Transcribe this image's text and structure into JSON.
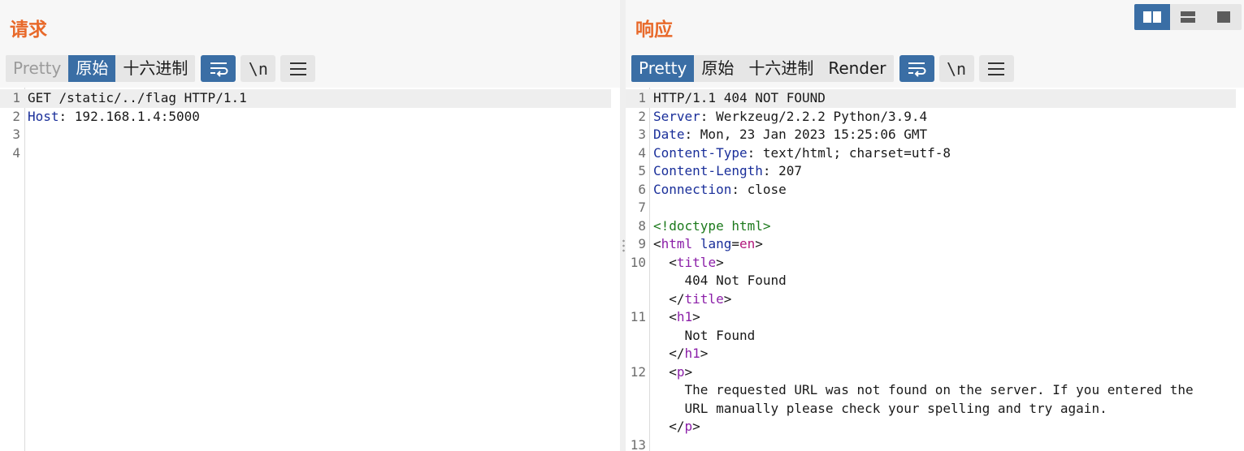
{
  "request": {
    "title": "请求",
    "view_tabs": [
      {
        "label": "Pretty",
        "state": "disabled"
      },
      {
        "label": "原始",
        "state": "active"
      },
      {
        "label": "十六进制",
        "state": "normal"
      }
    ],
    "newline_label": "\\n",
    "lines": [
      {
        "num": "1",
        "parts": [
          {
            "t": "GET /static/../flag HTTP/1.1",
            "c": ""
          }
        ]
      },
      {
        "num": "2",
        "parts": [
          {
            "t": "Host",
            "c": "hk"
          },
          {
            "t": ": 192.168.1.4:5000",
            "c": ""
          }
        ]
      },
      {
        "num": "3",
        "parts": []
      },
      {
        "num": "4",
        "parts": []
      }
    ]
  },
  "response": {
    "title": "响应",
    "view_tabs": [
      {
        "label": "Pretty",
        "state": "active"
      },
      {
        "label": "原始",
        "state": "normal"
      },
      {
        "label": "十六进制",
        "state": "normal"
      },
      {
        "label": "Render",
        "state": "normal"
      }
    ],
    "newline_label": "\\n",
    "lines": [
      {
        "num": "1",
        "parts": [
          {
            "t": "HTTP/1.1 404 NOT FOUND",
            "c": ""
          }
        ]
      },
      {
        "num": "2",
        "parts": [
          {
            "t": "Server",
            "c": "hk"
          },
          {
            "t": ": Werkzeug/2.2.2 Python/3.9.4",
            "c": ""
          }
        ]
      },
      {
        "num": "3",
        "parts": [
          {
            "t": "Date",
            "c": "hk"
          },
          {
            "t": ": Mon, 23 Jan 2023 15:25:06 GMT",
            "c": ""
          }
        ]
      },
      {
        "num": "4",
        "parts": [
          {
            "t": "Content-Type",
            "c": "hk"
          },
          {
            "t": ": text/html; charset=utf-8",
            "c": ""
          }
        ]
      },
      {
        "num": "5",
        "parts": [
          {
            "t": "Content-Length",
            "c": "hk"
          },
          {
            "t": ": 207",
            "c": ""
          }
        ]
      },
      {
        "num": "6",
        "parts": [
          {
            "t": "Connection",
            "c": "hk"
          },
          {
            "t": ": close",
            "c": ""
          }
        ]
      },
      {
        "num": "7",
        "parts": []
      },
      {
        "num": "8",
        "parts": [
          {
            "t": "<!doctype html>",
            "c": "doc"
          }
        ]
      },
      {
        "num": "9",
        "parts": [
          {
            "t": "<",
            "c": ""
          },
          {
            "t": "html",
            "c": "tag"
          },
          {
            "t": " ",
            "c": ""
          },
          {
            "t": "lang",
            "c": "attr"
          },
          {
            "t": "=",
            "c": ""
          },
          {
            "t": "en",
            "c": "aval"
          },
          {
            "t": ">",
            "c": ""
          }
        ]
      },
      {
        "num": "10",
        "parts": [
          {
            "t": "  <",
            "c": ""
          },
          {
            "t": "title",
            "c": "tag"
          },
          {
            "t": ">",
            "c": ""
          }
        ]
      },
      {
        "num": "",
        "parts": [
          {
            "t": "    404 Not Found",
            "c": ""
          }
        ]
      },
      {
        "num": "",
        "parts": [
          {
            "t": "  </",
            "c": ""
          },
          {
            "t": "title",
            "c": "tag"
          },
          {
            "t": ">",
            "c": ""
          }
        ]
      },
      {
        "num": "11",
        "parts": [
          {
            "t": "  <",
            "c": ""
          },
          {
            "t": "h1",
            "c": "tag"
          },
          {
            "t": ">",
            "c": ""
          }
        ]
      },
      {
        "num": "",
        "parts": [
          {
            "t": "    Not Found",
            "c": ""
          }
        ]
      },
      {
        "num": "",
        "parts": [
          {
            "t": "  </",
            "c": ""
          },
          {
            "t": "h1",
            "c": "tag"
          },
          {
            "t": ">",
            "c": ""
          }
        ]
      },
      {
        "num": "12",
        "parts": [
          {
            "t": "  <",
            "c": ""
          },
          {
            "t": "p",
            "c": "tag"
          },
          {
            "t": ">",
            "c": ""
          }
        ]
      },
      {
        "num": "",
        "parts": [
          {
            "t": "    The requested URL was not found on the server. If you entered the",
            "c": ""
          }
        ]
      },
      {
        "num": "",
        "parts": [
          {
            "t": "    URL manually please check your spelling and try again.",
            "c": ""
          }
        ]
      },
      {
        "num": "",
        "parts": [
          {
            "t": "  </",
            "c": ""
          },
          {
            "t": "p",
            "c": "tag"
          },
          {
            "t": ">",
            "c": ""
          }
        ]
      },
      {
        "num": "13",
        "parts": []
      }
    ]
  },
  "layout_buttons": [
    {
      "icon": "split-columns-icon",
      "active": true
    },
    {
      "icon": "split-rows-icon",
      "active": false
    },
    {
      "icon": "single-pane-icon",
      "active": false
    }
  ],
  "colors": {
    "accent": "#3a6ea5",
    "title": "#e8692a",
    "header_key": "#1a2f9a",
    "html_tag": "#8b1fa8",
    "doctype": "#1d7a1d",
    "attr_value": "#b2187c"
  }
}
